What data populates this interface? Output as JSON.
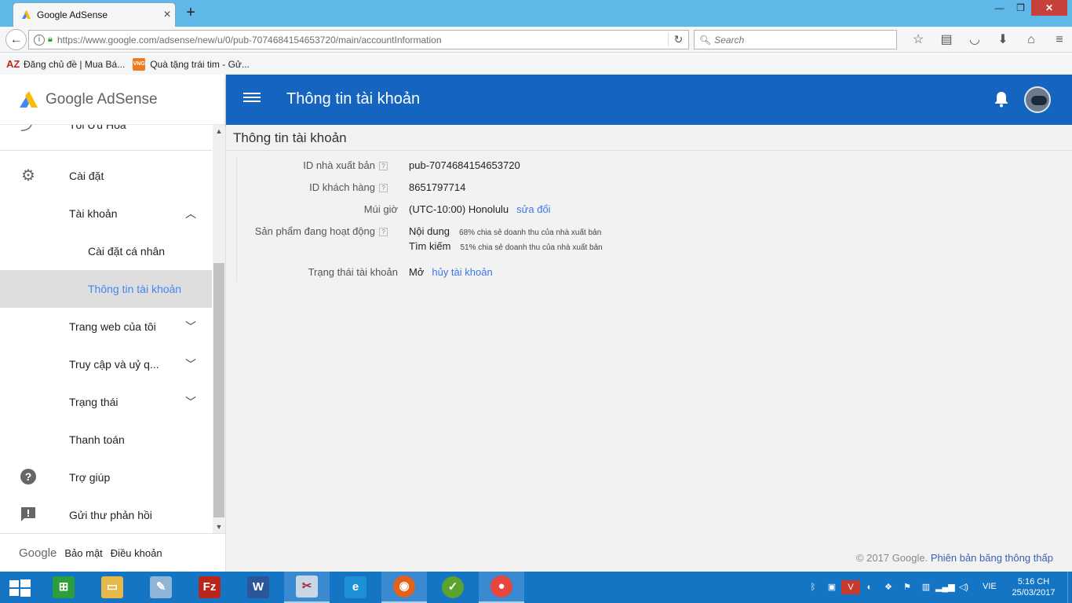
{
  "browser": {
    "tab_title": "Google AdSense",
    "url": "https://www.google.com/adsense/new/u/0/pub-7074684154653720/main/accountInformation",
    "search_placeholder": "Search",
    "bookmarks": [
      {
        "label": "Đăng chủ đề | Mua Bá...",
        "icon": "AZ"
      },
      {
        "label": "Quà tặng trái tim - Gử...",
        "icon": "VNG"
      }
    ]
  },
  "sidebar": {
    "logo_text": "Google AdSense",
    "items": [
      {
        "label": "Tối Ưu Hóa"
      },
      {
        "label": "Cài đặt"
      },
      {
        "label": "Tài khoản"
      },
      {
        "label": "Cài đặt cá nhân"
      },
      {
        "label": "Thông tin tài khoản"
      },
      {
        "label": "Trang web của tôi"
      },
      {
        "label": "Truy cập và uỷ q..."
      },
      {
        "label": "Trạng thái"
      },
      {
        "label": "Thanh toán"
      },
      {
        "label": "Trợ giúp"
      },
      {
        "label": "Gửi thư phản hồi"
      }
    ],
    "footer": {
      "google": "Google",
      "privacy": "Bảo mật",
      "terms": "Điều khoản"
    }
  },
  "appbar": {
    "title": "Thông tin tài khoản"
  },
  "content": {
    "heading": "Thông tin tài khoản",
    "rows": {
      "publisher_id": {
        "label": "ID nhà xuất bản",
        "value": "pub-7074684154653720"
      },
      "customer_id": {
        "label": "ID khách hàng",
        "value": "8651797714"
      },
      "timezone": {
        "label": "Múi giờ",
        "value": "(UTC-10:00) Honolulu",
        "link": "sửa đổi"
      },
      "products": {
        "label": "Sản phẩm đang hoạt động",
        "items": [
          {
            "name": "Nội dung",
            "note": "68% chia sẻ doanh thu của nhà xuất bản"
          },
          {
            "name": "Tìm kiếm",
            "note": "51% chia sẻ doanh thu của nhà xuất bản"
          }
        ]
      },
      "status": {
        "label": "Trạng thái tài khoản",
        "value": "Mở",
        "link": "hủy tài khoản"
      }
    },
    "copyright": "© 2017 Google.",
    "low_bandwidth": "Phiên bản băng thông thấp"
  },
  "taskbar": {
    "lang": "VIE",
    "time": "5:16 CH",
    "date": "25/03/2017"
  },
  "colors": {
    "appbar": "#1565c0",
    "link": "#3b78e7",
    "taskbar": "#1475c4"
  }
}
